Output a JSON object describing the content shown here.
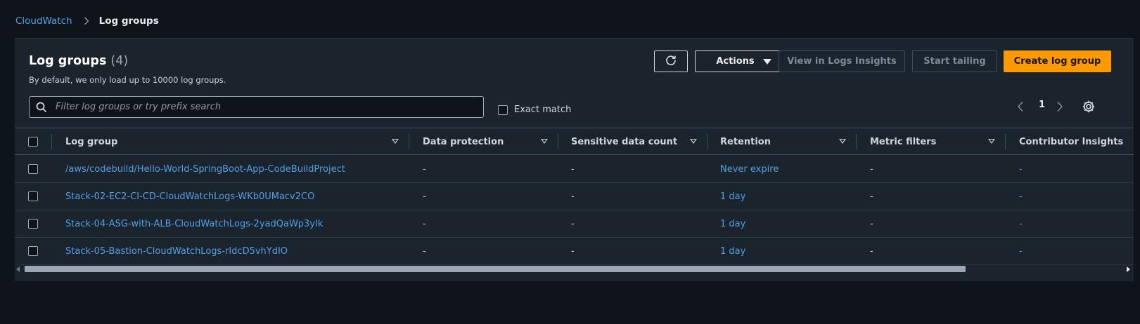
{
  "breadcrumb": {
    "root": "CloudWatch",
    "current": "Log groups"
  },
  "header": {
    "title": "Log groups",
    "count": "(4)",
    "subtitle": "By default, we only load up to 10000 log groups."
  },
  "toolbar": {
    "refresh_icon": "refresh-icon",
    "actions_label": "Actions",
    "insights_label": "View in Logs Insights",
    "tail_label": "Start tailing",
    "create_label": "Create log group"
  },
  "search": {
    "placeholder": "Filter log groups or try prefix search",
    "value": ""
  },
  "exact_match": {
    "label": "Exact match",
    "checked": false
  },
  "pagination": {
    "current_page": "1"
  },
  "table": {
    "columns": [
      "Log group",
      "Data protection",
      "Sensitive data count",
      "Retention",
      "Metric filters",
      "Contributor Insights"
    ],
    "rows": [
      {
        "log_group": "/aws/codebuild/Hello-World-SpringBoot-App-CodeBuildProject",
        "data_protection": "-",
        "sensitive_count": "-",
        "retention": "Never expire",
        "metric_filters": "-",
        "contributor": "-"
      },
      {
        "log_group": "Stack-02-EC2-CI-CD-CloudWatchLogs-WKb0UMacv2CO",
        "data_protection": "-",
        "sensitive_count": "-",
        "retention": "1 day",
        "metric_filters": "-",
        "contributor": "-"
      },
      {
        "log_group": "Stack-04-ASG-with-ALB-CloudWatchLogs-2yadQaWp3yIk",
        "data_protection": "-",
        "sensitive_count": "-",
        "retention": "1 day",
        "metric_filters": "-",
        "contributor": "-"
      },
      {
        "log_group": "Stack-05-Bastion-CloudWatchLogs-rIdcD5vhYdIO",
        "data_protection": "-",
        "sensitive_count": "-",
        "retention": "1 day",
        "metric_filters": "-",
        "contributor": "-"
      }
    ]
  },
  "colors": {
    "background": "#0f141a",
    "panel": "#1b232d",
    "link": "#539fe5",
    "primary_button": "#ff9900"
  }
}
